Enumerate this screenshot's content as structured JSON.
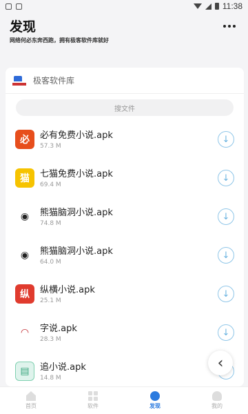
{
  "status_bar": {
    "time": "11:38"
  },
  "header": {
    "title": "发现",
    "subtitle": "网络何必东奔西跑，拥有极客软件库就好"
  },
  "library": {
    "name": "极客软件库",
    "search_placeholder": "搜文件"
  },
  "apps": [
    {
      "name": "必有免费小说.apk",
      "size": "57.3 M",
      "icon": "novel-red"
    },
    {
      "name": "七猫免费小说.apk",
      "size": "69.4 M",
      "icon": "cat"
    },
    {
      "name": "熊猫脑洞小说.apk",
      "size": "74.8 M",
      "icon": "panda"
    },
    {
      "name": "熊猫脑洞小说.apk",
      "size": "64.0 M",
      "icon": "panda"
    },
    {
      "name": "纵横小说.apk",
      "size": "25.1 M",
      "icon": "zongheng"
    },
    {
      "name": "字说.apk",
      "size": "28.3 M",
      "icon": "lips"
    },
    {
      "name": "追小说.apk",
      "size": "14.8 M",
      "icon": "book"
    }
  ],
  "bottom_nav": [
    {
      "label": "首页",
      "icon": "home-icon",
      "active": false
    },
    {
      "label": "软件",
      "icon": "grid-icon",
      "active": false
    },
    {
      "label": "发现",
      "icon": "discover-icon",
      "active": true
    },
    {
      "label": "我的",
      "icon": "user-icon",
      "active": false
    }
  ],
  "colors": {
    "accent": "#2a7adf",
    "download": "#6bb3e0"
  }
}
